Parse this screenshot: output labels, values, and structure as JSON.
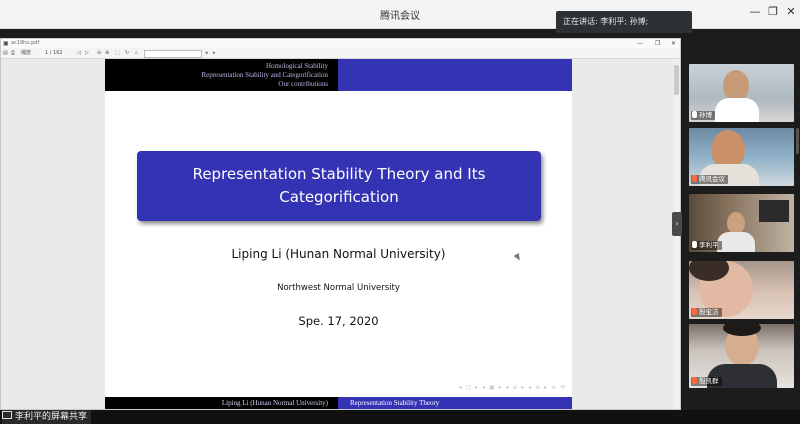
{
  "app": {
    "title": "腾讯会议"
  },
  "speaking": {
    "text": "正在讲话: 李利平; 孙博;"
  },
  "viewer": {
    "filename": "ac19hu.pdf",
    "toolbar": {
      "zoom": "缩放",
      "page": "1 / 162"
    }
  },
  "slide": {
    "header_nav": [
      "Homological Stability",
      "Representation Stability and Categorification",
      "Our contributions"
    ],
    "title_line1": "Representation Stability Theory and Its",
    "title_line2": "Categorification",
    "author": "Liping Li (Hunan Normal University)",
    "institution": "Northwest Normal University",
    "date": "Spe. 17, 2020",
    "footer_left": "Liping Li (Hunan Normal University)",
    "footer_right": "Representation Stability Theory"
  },
  "participants": [
    {
      "name": "孙博",
      "muted": false
    },
    {
      "name": "腾讯会议",
      "muted": true
    },
    {
      "name": "李利平",
      "muted": false
    },
    {
      "name": "殷宝洁",
      "muted": true
    },
    {
      "name": "殷凯群",
      "muted": true
    }
  ],
  "status": {
    "share_text": "李利平的屏幕共享"
  }
}
